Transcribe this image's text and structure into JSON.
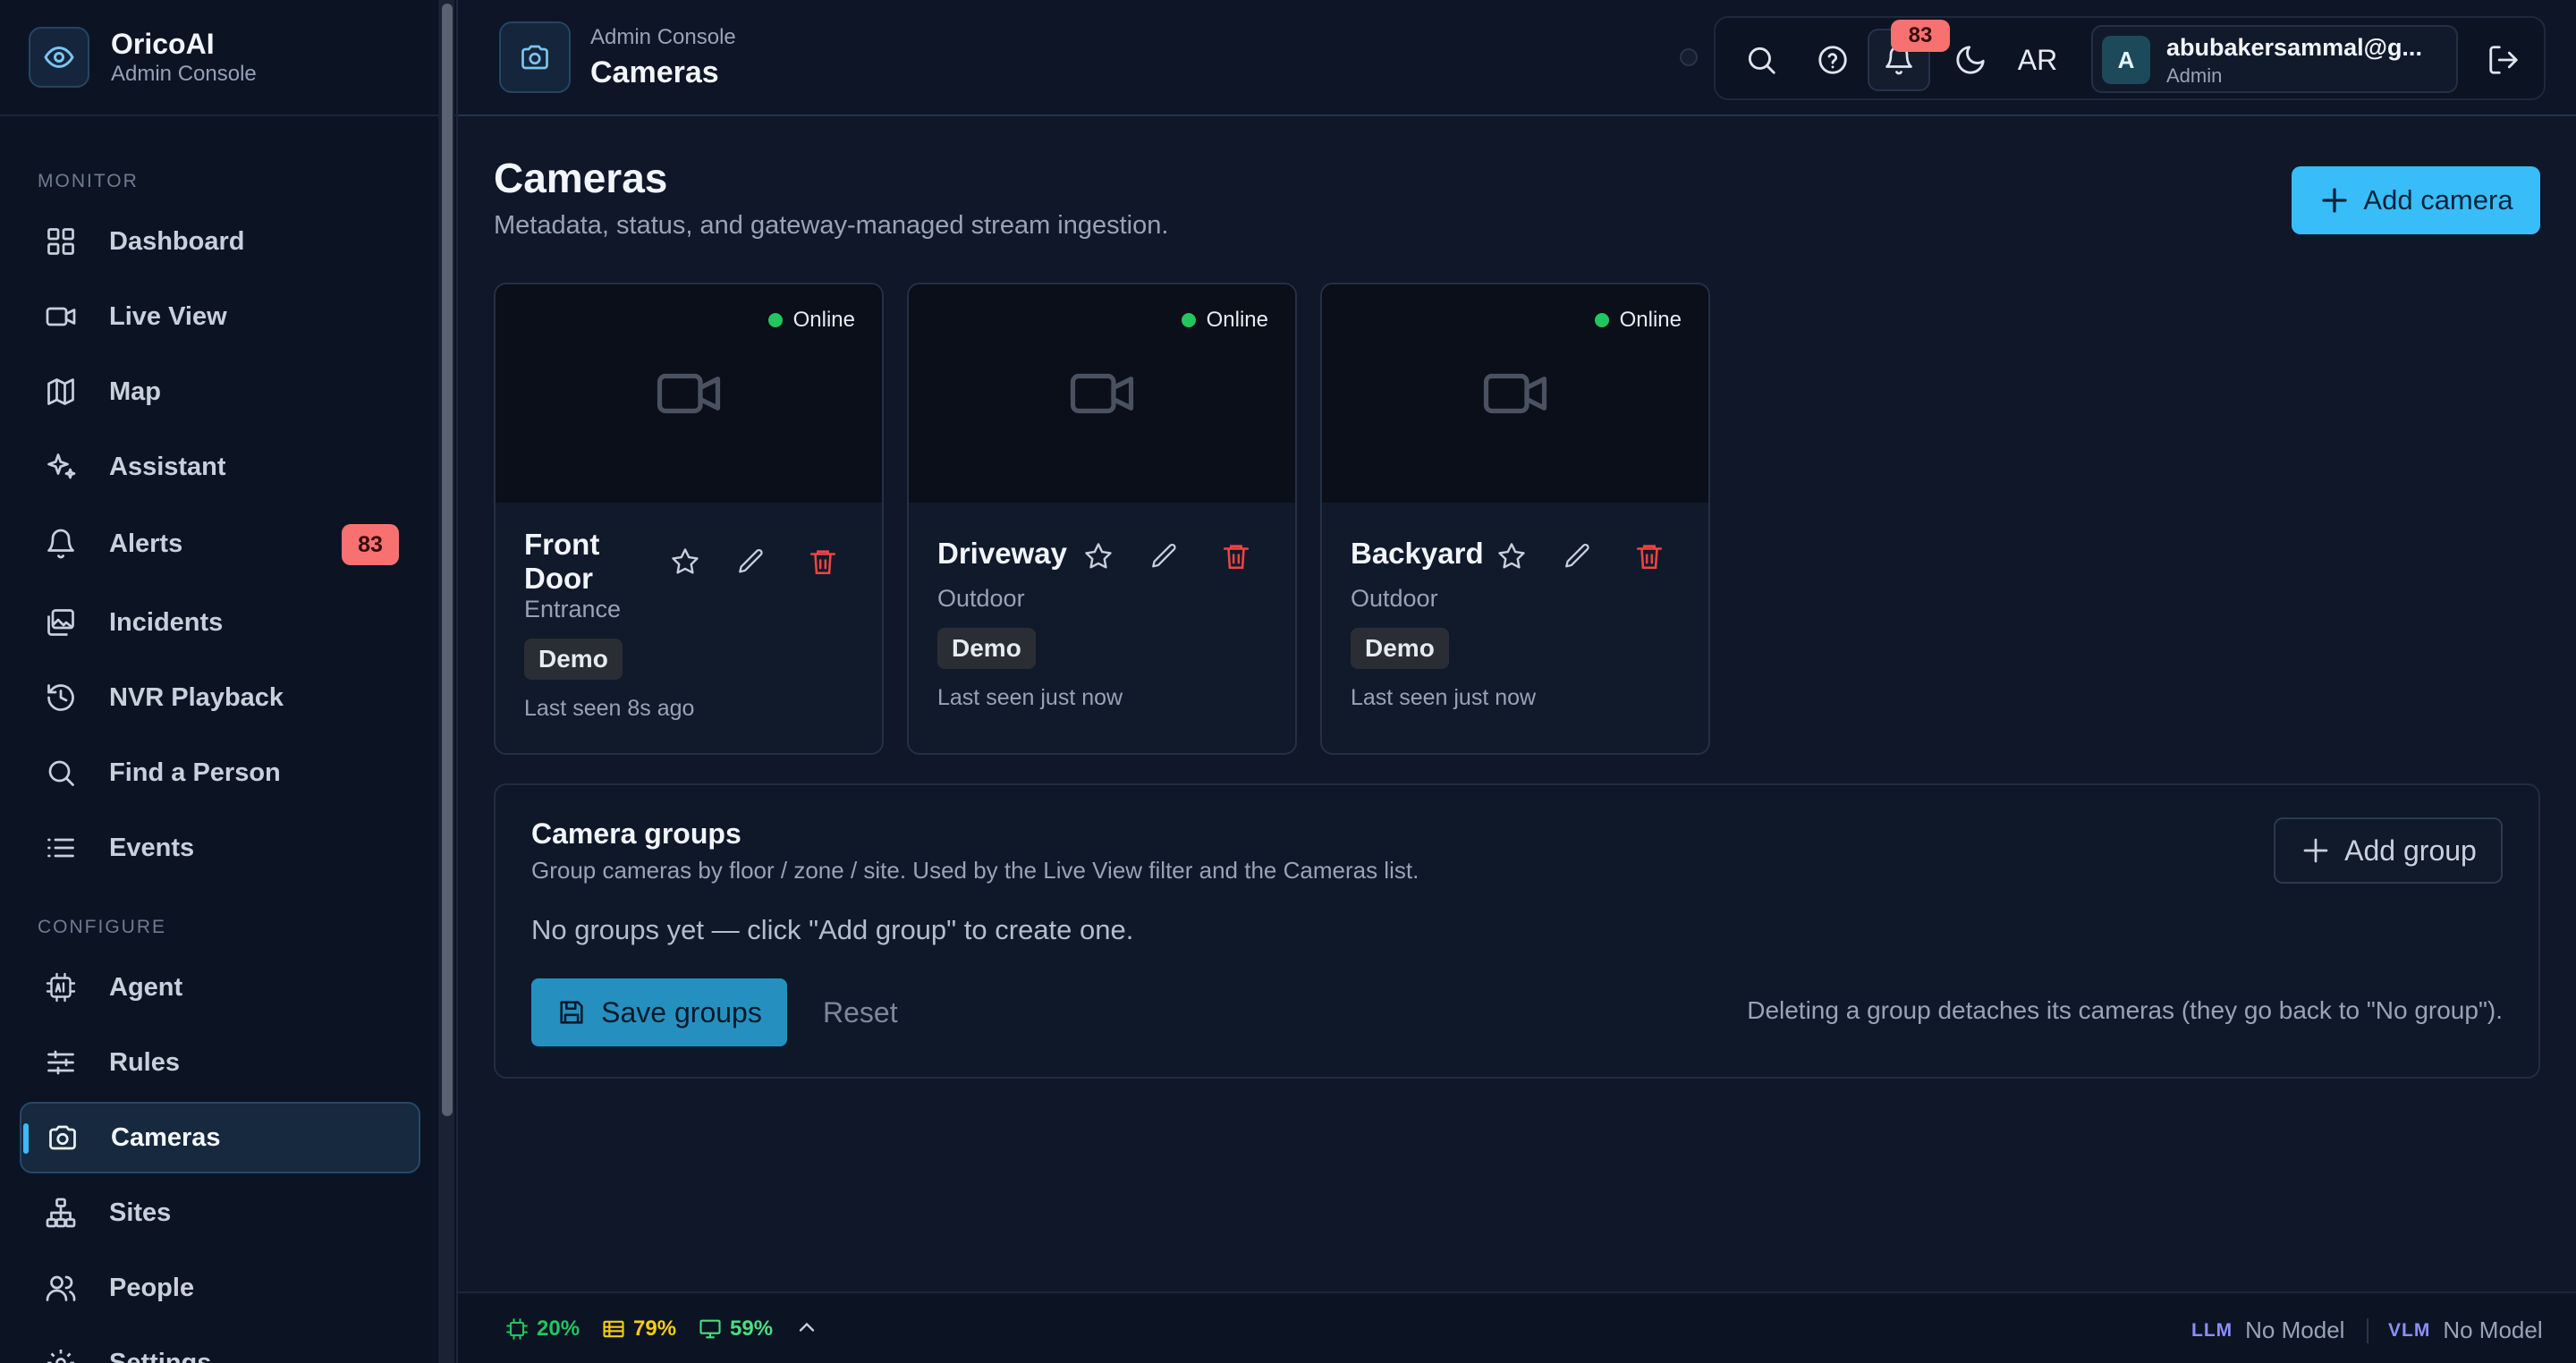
{
  "brand": {
    "name": "OricoAI",
    "subtitle": "Admin Console"
  },
  "sidebar": {
    "sections": {
      "monitor": "MONITOR",
      "configure": "CONFIGURE"
    },
    "items": [
      {
        "label": "Dashboard",
        "icon": "grid-icon"
      },
      {
        "label": "Live View",
        "icon": "video-icon"
      },
      {
        "label": "Map",
        "icon": "map-icon"
      },
      {
        "label": "Assistant",
        "icon": "sparkle-icon"
      },
      {
        "label": "Alerts",
        "icon": "bell-icon",
        "badge": "83"
      },
      {
        "label": "Incidents",
        "icon": "images-icon"
      },
      {
        "label": "NVR Playback",
        "icon": "history-icon"
      },
      {
        "label": "Find a Person",
        "icon": "search-icon"
      },
      {
        "label": "Events",
        "icon": "list-icon"
      },
      {
        "label": "Agent",
        "icon": "ai-chip-icon"
      },
      {
        "label": "Rules",
        "icon": "sliders-icon"
      },
      {
        "label": "Cameras",
        "icon": "camera-icon",
        "active": true
      },
      {
        "label": "Sites",
        "icon": "network-icon"
      },
      {
        "label": "People",
        "icon": "users-icon"
      },
      {
        "label": "Settings",
        "icon": "gear-icon"
      }
    ]
  },
  "header": {
    "breadcrumb": "Admin Console",
    "title": "Cameras",
    "notification_count": "83",
    "language": "AR",
    "user": {
      "initial": "A",
      "email": "abubakersammal@g...",
      "role": "Admin"
    }
  },
  "main": {
    "title": "Cameras",
    "subtitle": "Metadata, status, and gateway-managed stream ingestion.",
    "add_camera_label": "Add camera"
  },
  "cameras": [
    {
      "name": "Front Door",
      "zone": "Entrance",
      "tag": "Demo",
      "status": "Online",
      "last_seen": "Last seen 8s ago"
    },
    {
      "name": "Driveway",
      "zone": "Outdoor",
      "tag": "Demo",
      "status": "Online",
      "last_seen": "Last seen just now"
    },
    {
      "name": "Backyard",
      "zone": "Outdoor",
      "tag": "Demo",
      "status": "Online",
      "last_seen": "Last seen just now"
    }
  ],
  "groups": {
    "title": "Camera groups",
    "subtitle": "Group cameras by floor / zone / site. Used by the Live View filter and the Cameras list.",
    "empty": "No groups yet — click \"Add group\" to create one.",
    "add_label": "Add group",
    "save_label": "Save groups",
    "reset_label": "Reset",
    "note": "Deleting a group detaches its cameras (they go back to \"No group\")."
  },
  "statusbar": {
    "cpu": "20%",
    "memory": "79%",
    "gpu": "59%",
    "llm_key": "LLM",
    "llm_value": "No Model",
    "vlm_key": "VLM",
    "vlm_value": "No Model"
  },
  "colors": {
    "accent": "#38bdf8",
    "badge": "#f87171",
    "online": "#22c55e",
    "cpu": "#22c55e",
    "memory": "#facc15",
    "gpu": "#4ade80",
    "delete": "#ef4444"
  }
}
